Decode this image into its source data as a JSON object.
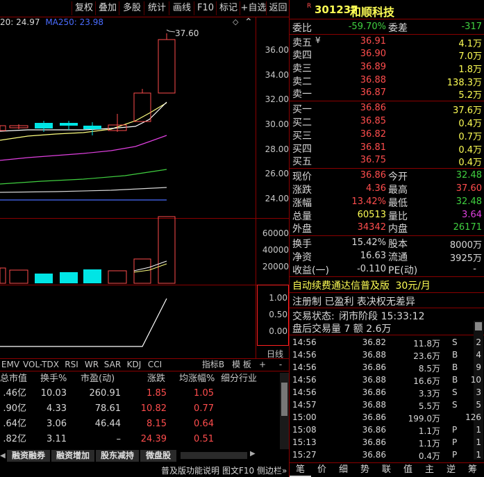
{
  "toolbar": {
    "items": [
      "复权",
      "叠加",
      "多股",
      "统计",
      "画线",
      "F10",
      "标记",
      "+自选",
      "返回"
    ]
  },
  "ma": {
    "left": "20: 24.97",
    "ma250": "MA250: 23.98"
  },
  "price_chart": {
    "high_label": "37.60",
    "y_ticks": [
      "36.00",
      "34.00",
      "32.00",
      "30.00",
      "28.00",
      "26.00",
      "24.00"
    ],
    "vol_ticks": [
      "60000",
      "40000",
      "20000"
    ],
    "ind_ticks": [
      "1.00",
      "0.50",
      "0.00"
    ],
    "day_line": "日线"
  },
  "indicator_tabs": [
    "EMV",
    "VOL-TDX",
    "RSI",
    "WR",
    "SAR",
    "KDJ",
    "CCI"
  ],
  "indicator_right": {
    "label": "指标B",
    "template": "模 板",
    "plus": "+",
    "minus": "-"
  },
  "table": {
    "headers": [
      "总市值",
      "换手%",
      "市盈(动)",
      "涨跌",
      "均涨幅%",
      "细分行业"
    ],
    "rows": [
      [
        ".46亿",
        "10.03",
        "260.91",
        "1.85",
        "1.05",
        ""
      ],
      [
        ".90亿",
        "4.33",
        "78.61",
        "10.82",
        "0.77",
        ""
      ],
      [
        ".64亿",
        "3.06",
        "46.44",
        "8.15",
        "0.64",
        ""
      ],
      [
        ".82亿",
        "3.11",
        "–",
        "24.39",
        "0.51",
        ""
      ]
    ]
  },
  "quick_tabs": [
    "融资融券",
    "融资增加",
    "股东减持",
    "微盘股"
  ],
  "status_bar": {
    "text1": "普及版功能说明",
    "text2": "图文F10",
    "text3": "侧边栏»"
  },
  "stock": {
    "badge": "R",
    "code": "301237",
    "name": "和顺科技"
  },
  "weibi": {
    "label1": "委比",
    "value1": "-59.70%",
    "label2": "委差",
    "value2": "-317"
  },
  "asks": [
    {
      "label": "卖五",
      "flag": "¥",
      "price": "36.91",
      "vol": "4.1万"
    },
    {
      "label": "卖四",
      "flag": "",
      "price": "36.90",
      "vol": "7.0万"
    },
    {
      "label": "卖三",
      "flag": "",
      "price": "36.89",
      "vol": "1.8万"
    },
    {
      "label": "卖二",
      "flag": "",
      "price": "36.88",
      "vol": "138.3万"
    },
    {
      "label": "卖一",
      "flag": "",
      "price": "36.87",
      "vol": "5.2万"
    }
  ],
  "bids": [
    {
      "label": "买一",
      "price": "36.86",
      "vol": "37.6万"
    },
    {
      "label": "买二",
      "price": "36.85",
      "vol": "0.4万"
    },
    {
      "label": "买三",
      "price": "36.82",
      "vol": "0.7万"
    },
    {
      "label": "买四",
      "price": "36.81",
      "vol": "0.4万"
    },
    {
      "label": "买五",
      "price": "36.75",
      "vol": "0.4万"
    }
  ],
  "stats": [
    {
      "l1": "现价",
      "v1": "36.86",
      "l2": "今开",
      "v2": "32.48",
      "c1": "r",
      "c2": "g"
    },
    {
      "l1": "涨跌",
      "v1": "4.36",
      "l2": "最高",
      "v2": "37.60",
      "c1": "r",
      "c2": "r"
    },
    {
      "l1": "涨幅",
      "v1": "13.42%",
      "l2": "最低",
      "v2": "32.48",
      "c1": "r",
      "c2": "g"
    },
    {
      "l1": "总量",
      "v1": "60513",
      "l2": "量比",
      "v2": "3.64",
      "c1": "y",
      "c2": "m"
    },
    {
      "l1": "外盘",
      "v1": "34342",
      "l2": "内盘",
      "v2": "26171",
      "c1": "r",
      "c2": "g"
    }
  ],
  "stats2": [
    {
      "l1": "换手",
      "v1": "15.42%",
      "l2": "股本",
      "v2": "8000万"
    },
    {
      "l1": "净资",
      "v1": "16.63",
      "l2": "流通",
      "v2": "3925万"
    },
    {
      "l1": "收益(一)",
      "v1": "-0.110",
      "l2": "PE(动)",
      "v2": "-"
    }
  ],
  "promo": {
    "text": "自动续费通达信普及版",
    "price": "30元/月"
  },
  "flags": "注册制 已盈利 表决权无差异",
  "trade_status": {
    "label": "交易状态:",
    "value": "闭市阶段 15:33:12"
  },
  "after_hours": "盘后交易量 7 额 2.6万",
  "ticks": [
    {
      "t": "14:56",
      "p": "36.82",
      "v": "11.8万",
      "s": "S",
      "n": "2",
      "vc": "y",
      "sc": "g"
    },
    {
      "t": "14:56",
      "p": "36.88",
      "v": "23.6万",
      "s": "B",
      "n": "4",
      "vc": "y",
      "sc": "r"
    },
    {
      "t": "14:56",
      "p": "36.86",
      "v": "8.5万",
      "s": "B",
      "n": "9",
      "vc": "y",
      "sc": "r"
    },
    {
      "t": "14:56",
      "p": "36.88",
      "v": "16.6万",
      "s": "B",
      "n": "10",
      "vc": "y",
      "sc": "r"
    },
    {
      "t": "14:56",
      "p": "36.86",
      "v": "3.3万",
      "s": "S",
      "n": "3",
      "vc": "y",
      "sc": "g"
    },
    {
      "t": "14:57",
      "p": "36.88",
      "v": "5.5万",
      "s": "S",
      "n": "5",
      "vc": "y",
      "sc": "g"
    },
    {
      "t": "15:00",
      "p": "36.86",
      "v": "199.0万",
      "s": "",
      "n": "126",
      "vc": "m",
      "sc": "w"
    },
    {
      "t": "15:08",
      "p": "36.86",
      "v": "1.1万",
      "s": "P",
      "n": "1",
      "vc": "y",
      "sc": "w"
    },
    {
      "t": "15:13",
      "p": "36.86",
      "v": "1.1万",
      "s": "P",
      "n": "1",
      "vc": "y",
      "sc": "w"
    },
    {
      "t": "15:27",
      "p": "36.86",
      "v": "0.4万",
      "s": "P",
      "n": "1",
      "vc": "y",
      "sc": "w"
    }
  ],
  "bottom_tabs": [
    "笔",
    "价",
    "细",
    "势",
    "联",
    "值",
    "主",
    "逆",
    "筹"
  ],
  "colors": {
    "up": "#ff4d4d",
    "down": "#40d040",
    "frame": "#8b0000",
    "cyan": "#00e5e5"
  }
}
